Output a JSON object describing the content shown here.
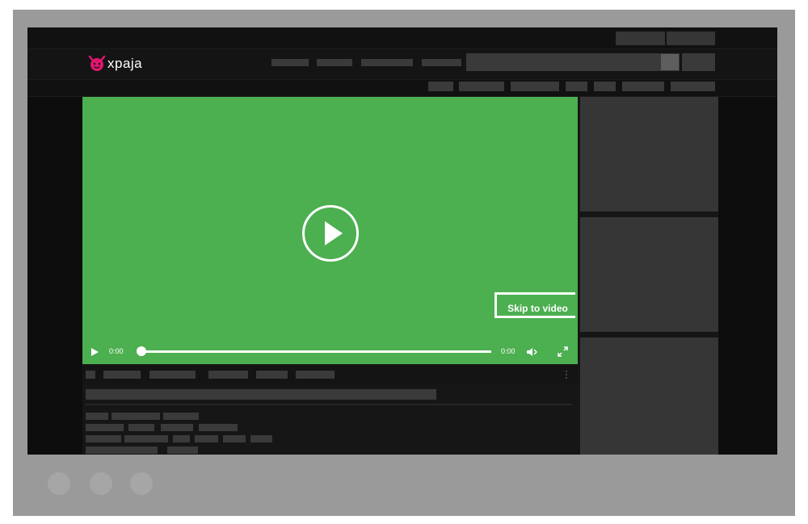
{
  "app": {
    "logo_text": "xpaja",
    "logo_icon": "devil-face-icon",
    "brand_color": "#e0166e"
  },
  "player": {
    "background_color": "#4caf50",
    "skip_label": "Skip to video",
    "current_time": "0:00",
    "duration": "0:00",
    "progress": 0,
    "icons": {
      "big_play": "play-circle-icon",
      "play": "play-icon",
      "volume": "volume-icon",
      "fullscreen": "fullscreen-icon",
      "more": "more-vertical-icon"
    }
  },
  "desktop": {
    "taskbar_dots": 3
  }
}
